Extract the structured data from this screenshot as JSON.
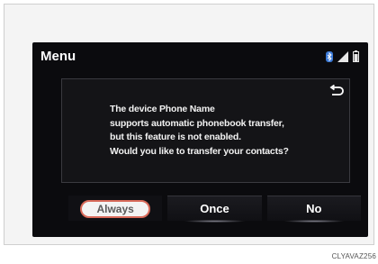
{
  "screen": {
    "title": "Menu"
  },
  "status_icons": [
    "bluetooth-icon",
    "signal-strength-icon",
    "battery-icon"
  ],
  "dialog": {
    "lines": [
      "The device Phone Name",
      "supports automatic phonebook transfer,",
      "but this feature is not enabled.",
      "Would you like to transfer your contacts?"
    ],
    "back_icon": "back-arrow-icon"
  },
  "buttons": {
    "always": "Always",
    "once": "Once",
    "no": "No",
    "selected": "always"
  },
  "figure_code": "CLYAVAZ256"
}
